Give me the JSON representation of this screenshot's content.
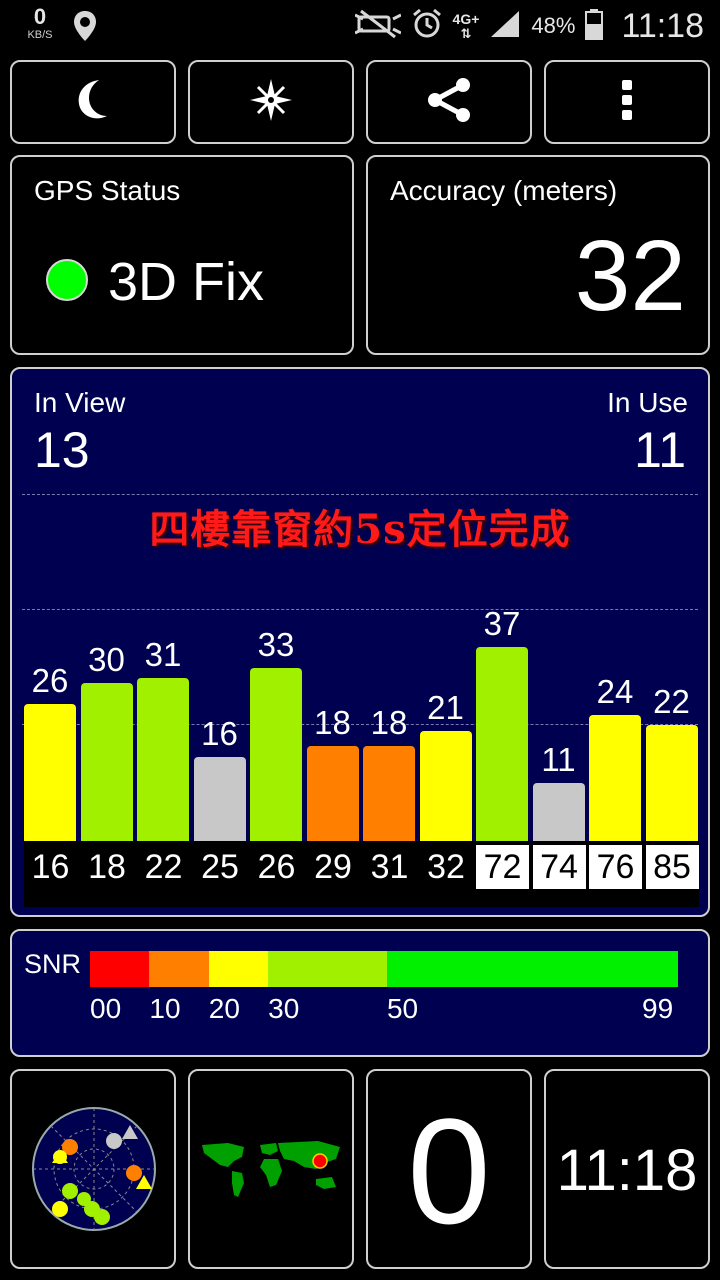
{
  "status_bar": {
    "speed_value": "0",
    "speed_unit": "KB/S",
    "network": "4G+",
    "battery": "48%",
    "time": "11:18",
    "icons": [
      "location-pin-icon",
      "mute-icon",
      "alarm-icon",
      "signal-icon",
      "battery-icon"
    ]
  },
  "toolbar": {
    "buttons": [
      "night-mode-icon",
      "compass-icon",
      "share-icon",
      "more-options-icon"
    ]
  },
  "gps_status": {
    "title": "GPS Status",
    "fix": "3D Fix",
    "fix_color": "#00ff00"
  },
  "accuracy": {
    "title": "Accuracy (meters)",
    "value": "32"
  },
  "satellites": {
    "in_view_label": "In View",
    "in_view": "13",
    "in_use_label": "In Use",
    "in_use": "11",
    "note": "四樓靠窗約5s定位完成",
    "bars": [
      {
        "prn": "16",
        "snr": 26,
        "color": "#ffff00",
        "in_use": false
      },
      {
        "prn": "18",
        "snr": 30,
        "color": "#a0f000",
        "in_use": false
      },
      {
        "prn": "22",
        "snr": 31,
        "color": "#a0f000",
        "in_use": false
      },
      {
        "prn": "25",
        "snr": 16,
        "color": "#c8c8c8",
        "in_use": false
      },
      {
        "prn": "26",
        "snr": 33,
        "color": "#a0f000",
        "in_use": false
      },
      {
        "prn": "29",
        "snr": 18,
        "color": "#ff8000",
        "in_use": false
      },
      {
        "prn": "31",
        "snr": 18,
        "color": "#ff8000",
        "in_use": false
      },
      {
        "prn": "32",
        "snr": 21,
        "color": "#ffff00",
        "in_use": false
      },
      {
        "prn": "72",
        "snr": 37,
        "color": "#a0f000",
        "in_use": true
      },
      {
        "prn": "74",
        "snr": 11,
        "color": "#c8c8c8",
        "in_use": true
      },
      {
        "prn": "76",
        "snr": 24,
        "color": "#ffff00",
        "in_use": true
      },
      {
        "prn": "85",
        "snr": 22,
        "color": "#ffff00",
        "in_use": true
      }
    ]
  },
  "snr_legend": {
    "label": "SNR",
    "segments": [
      {
        "from": 0,
        "to": 10,
        "color": "#ff0000"
      },
      {
        "from": 10,
        "to": 20,
        "color": "#ff8000"
      },
      {
        "from": 20,
        "to": 30,
        "color": "#ffff00"
      },
      {
        "from": 30,
        "to": 50,
        "color": "#a0f000"
      },
      {
        "from": 50,
        "to": 99,
        "color": "#00f000"
      }
    ],
    "ticks": [
      "00",
      "10",
      "20",
      "30",
      "50",
      "99"
    ]
  },
  "bottom": {
    "counter": "0",
    "clock": "11:18",
    "icons": [
      "sky-view-radar-icon",
      "world-map-icon"
    ]
  }
}
